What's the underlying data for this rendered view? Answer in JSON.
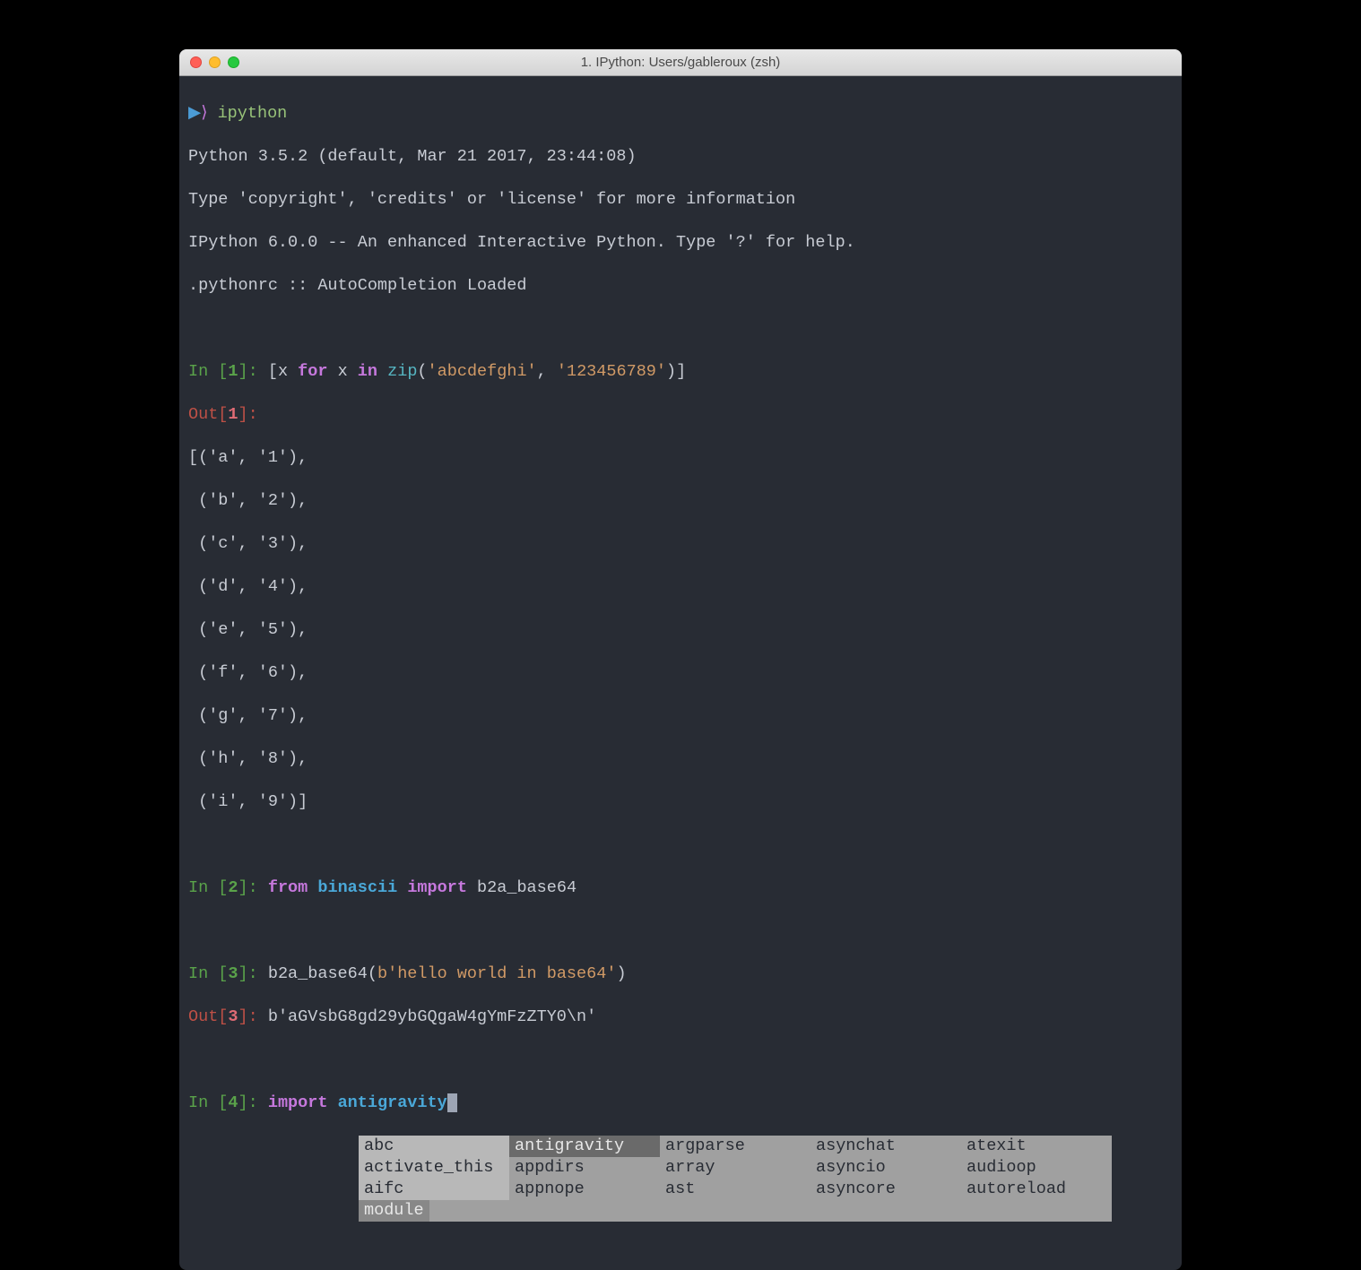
{
  "window": {
    "title": "1. IPython: Users/gableroux (zsh)"
  },
  "shell": {
    "prompt_arrow": "▶",
    "prompt_paren": "⟩",
    "command": "ipython"
  },
  "banner": {
    "line1": "Python 3.5.2 (default, Mar 21 2017, 23:44:08)",
    "line2": "Type 'copyright', 'credits' or 'license' for more information",
    "line3": "IPython 6.0.0 -- An enhanced Interactive Python. Type '?' for help.",
    "line4": ".pythonrc :: AutoCompletion Loaded"
  },
  "cells": {
    "in1": {
      "label": "In [",
      "num": "1",
      "close": "]: ",
      "code_open": "[x ",
      "kw_for": "for",
      "code_mid1": " x ",
      "kw_in": "in",
      "code_mid2": " ",
      "func": "zip",
      "paren_open": "(",
      "str1": "'abcdefghi'",
      "comma": ", ",
      "str2": "'123456789'",
      "paren_close": ")]"
    },
    "out1": {
      "label": "Out[",
      "num": "1",
      "close": "]: ",
      "lines": [
        "[('a', '1'),",
        " ('b', '2'),",
        " ('c', '3'),",
        " ('d', '4'),",
        " ('e', '5'),",
        " ('f', '6'),",
        " ('g', '7'),",
        " ('h', '8'),",
        " ('i', '9')]"
      ]
    },
    "in2": {
      "label": "In [",
      "num": "2",
      "close": "]: ",
      "kw_from": "from",
      "sp1": " ",
      "module": "binascii",
      "sp2": " ",
      "kw_import": "import",
      "sp3": " ",
      "name": "b2a_base64"
    },
    "in3": {
      "label": "In [",
      "num": "3",
      "close": "]: ",
      "func": "b2a_base64",
      "paren_open": "(",
      "arg": "b'hello world in base64'",
      "paren_close": ")"
    },
    "out3": {
      "label": "Out[",
      "num": "3",
      "close": "]: ",
      "value": "b'aGVsbG8gd29ybGQgaW4gYmFzZTY0\\n'"
    },
    "in4": {
      "label": "In [",
      "num": "4",
      "close": "]: ",
      "kw_import": "import",
      "sp": " ",
      "module": "antigravity"
    }
  },
  "completion": {
    "selected": "antigravity",
    "footer": "module",
    "grid": [
      [
        "abc",
        "antigravity",
        "argparse",
        "asynchat",
        "atexit"
      ],
      [
        "activate_this",
        "appdirs",
        "array",
        "asyncio",
        "audioop"
      ],
      [
        "aifc",
        "appnope",
        "ast",
        "asyncore",
        "autoreload"
      ]
    ]
  }
}
